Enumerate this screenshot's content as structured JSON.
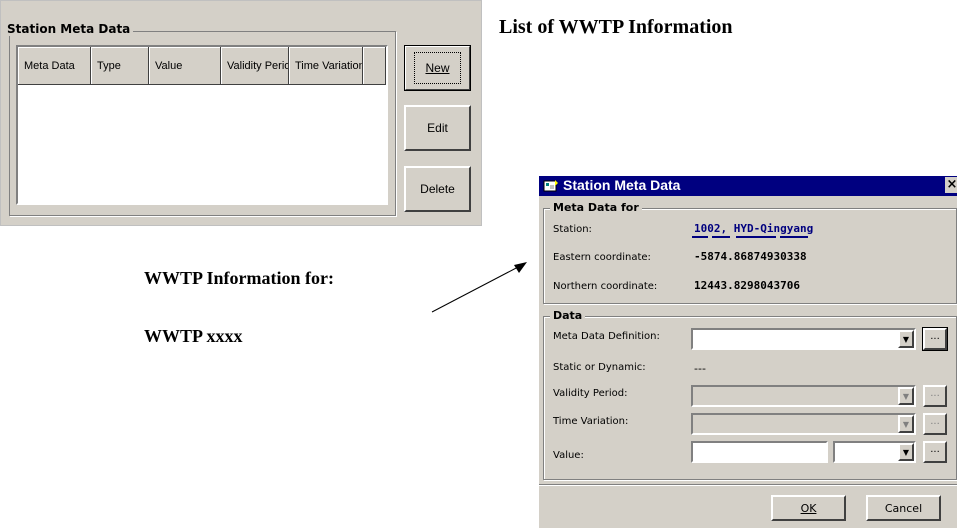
{
  "panel": {
    "group_title": "Station Meta Data",
    "columns": [
      "Meta Data",
      "Type",
      "Value",
      "Validity Period",
      "Time Variation"
    ],
    "buttons": {
      "new": "New",
      "edit": "Edit",
      "delete": "Delete"
    }
  },
  "annotations": {
    "list_title": "List of WWTP Information",
    "info_for": "WWTP Information for:",
    "wwtp_name": "WWTP  xxxx"
  },
  "dialog": {
    "title": "Station Meta Data",
    "meta_group": "Meta Data for",
    "station_label": "Station:",
    "station_value": "1002, HYD-Qingyang",
    "eastern_label": "Eastern coordinate:",
    "eastern_value": "-5874.86874930338",
    "northern_label": "Northern coordinate:",
    "northern_value": "12443.8298043706",
    "data_group": "Data",
    "definition_label": "Meta Data Definition:",
    "static_label": "Static or Dynamic:",
    "static_value": "---",
    "validity_label": "Validity Period:",
    "time_variation_label": "Time Variation:",
    "value_label": "Value:",
    "dots": "...",
    "ok": "OK",
    "cancel": "Cancel",
    "close": "×"
  }
}
